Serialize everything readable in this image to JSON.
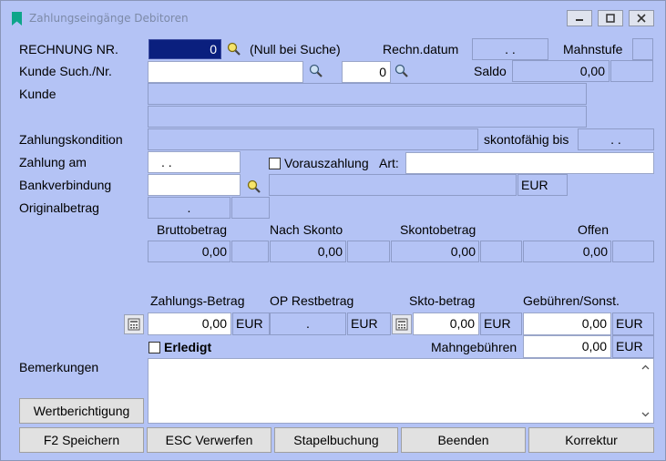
{
  "window": {
    "title": "Zahlungseingänge Debitoren",
    "accent": "#0ea58a"
  },
  "form": {
    "rechnung_nr_label": "RECHNUNG NR.",
    "rechnung_nr_value": "0",
    "null_bei_suche": "(Null bei Suche)",
    "rechn_datum_label": "Rechn.datum",
    "rechn_datum_value": ". .",
    "mahnstufe_label": "Mahnstufe",
    "kunde_such_label": "Kunde Such./Nr.",
    "kunde_nr_value": "0",
    "saldo_label": "Saldo",
    "saldo_value": "0,00",
    "kunde_label": "Kunde",
    "zahlungskondition_label": "Zahlungskondition",
    "skontofaehig_label": "skontofähig bis",
    "skontofaehig_value": ". .",
    "zahlung_am_label": "Zahlung am",
    "zahlung_am_value": ". .",
    "vorauszahlung_label": "Vorauszahlung",
    "art_label": "Art:",
    "bankverbindung_label": "Bankverbindung",
    "bank_currency": "EUR",
    "originalbetrag_label": "Originalbetrag",
    "originalbetrag_value": "."
  },
  "amounts": {
    "headers": [
      "Bruttobetrag",
      "Nach Skonto",
      "Skontobetrag",
      "Offen"
    ],
    "values": [
      "0,00",
      "0,00",
      "0,00",
      "0,00"
    ]
  },
  "payment": {
    "headers": [
      "Zahlungs-Betrag",
      "OP Restbetrag",
      "Skto-betrag",
      "Gebühren/Sonst."
    ],
    "zahlungs_betrag": "0,00",
    "zahlungs_currency": "EUR",
    "op_restbetrag": ".",
    "op_currency": "EUR",
    "skto_betrag": "0,00",
    "skto_currency": "EUR",
    "gebuehren": "0,00",
    "gebuehren_currency": "EUR",
    "erledigt_label": "Erledigt",
    "mahngebuehren_label": "Mahngebühren",
    "mahngebuehren_value": "0,00",
    "mahngebuehren_currency": "EUR"
  },
  "bemerkungen_label": "Bemerkungen",
  "buttons": {
    "wertberichtigung": "Wertberichtigung",
    "speichern": "F2  Speichern",
    "verwerfen": "ESC  Verwerfen",
    "stapelbuchung": "Stapelbuchung",
    "beenden": "Beenden",
    "korrektur": "Korrektur"
  }
}
